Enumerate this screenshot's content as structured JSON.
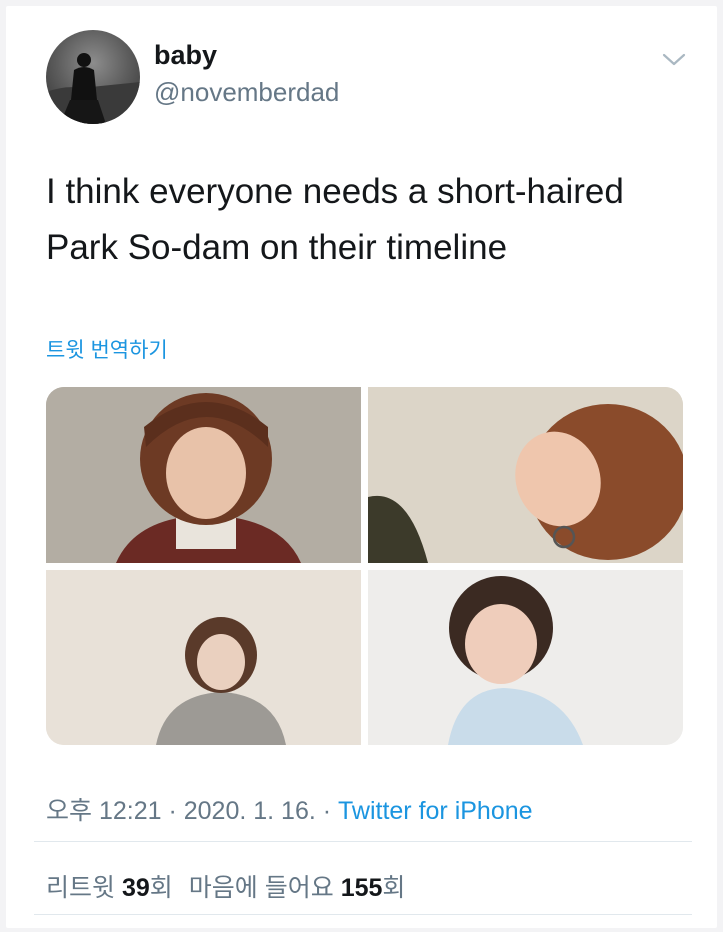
{
  "author": {
    "name": "baby",
    "handle": "@novemberdad"
  },
  "icons": {
    "menu": "chevron-down-icon",
    "avatar": "avatar-silhouette"
  },
  "tweet": {
    "lines": [
      "I think everyone needs a short-haired",
      "Park So-dam on their timeline"
    ],
    "translate_label": "트윗 번역하기"
  },
  "media": {
    "count": 4
  },
  "meta": {
    "time": "오후 12:21",
    "separator1": " · ",
    "date": "2020. 1. 16.",
    "separator2": " · ",
    "source": "Twitter for iPhone"
  },
  "stats": {
    "retweets_label": "리트윗 ",
    "retweets_count": "39",
    "retweets_unit": "회",
    "likes_label": "마음에 들어요 ",
    "likes_count": "155",
    "likes_unit": "회"
  },
  "colors": {
    "link": "#1b95e0",
    "secondary_text": "#657786",
    "primary_text": "#14171a",
    "divider": "#e1e8ed"
  }
}
